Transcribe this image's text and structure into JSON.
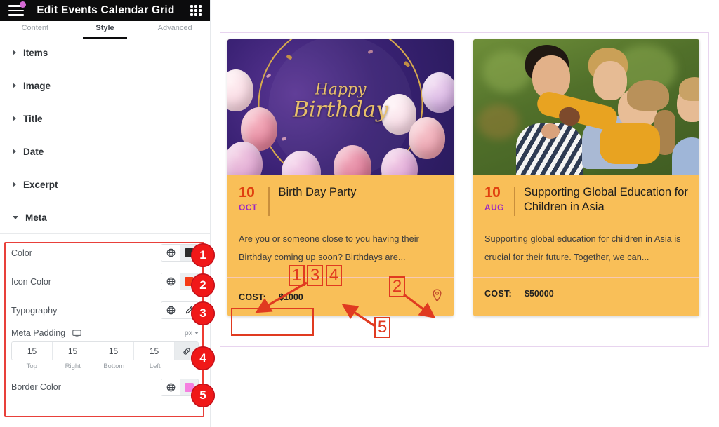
{
  "topbar": {
    "menu_icon": "hamburger-menu-icon",
    "title": "Edit Events Calendar Grid",
    "apps_icon": "apps-grid-icon",
    "badge_color": "#d66bd6"
  },
  "tabs": [
    {
      "label": "Content",
      "active": false
    },
    {
      "label": "Style",
      "active": true
    },
    {
      "label": "Advanced",
      "active": false
    }
  ],
  "sections": [
    {
      "label": "Items",
      "open": false
    },
    {
      "label": "Image",
      "open": false
    },
    {
      "label": "Title",
      "open": false
    },
    {
      "label": "Date",
      "open": false
    },
    {
      "label": "Excerpt",
      "open": false
    },
    {
      "label": "Meta",
      "open": true
    }
  ],
  "meta_controls": {
    "color": {
      "label": "Color",
      "globe_icon": "globe-icon",
      "swatch_icon": "color-swatch",
      "swatch_color": "#2c2c2c"
    },
    "icon_color": {
      "label": "Icon Color",
      "globe_icon": "globe-icon",
      "swatch_icon": "color-swatch",
      "swatch_color": "#f53b16"
    },
    "typography": {
      "label": "Typography",
      "globe_icon": "globe-icon",
      "edit_icon": "pencil-edit-icon"
    },
    "padding": {
      "label": "Meta Padding",
      "device_icon": "desktop-monitor-icon",
      "unit": "px",
      "unit_chevron": "chevron-down-icon",
      "values": [
        "15",
        "15",
        "15",
        "15"
      ],
      "sides": [
        "Top",
        "Right",
        "Bottom",
        "Left"
      ],
      "link_icon": "link-chain-icon"
    },
    "border_color": {
      "label": "Border Color",
      "globe_icon": "globe-icon",
      "swatch_icon": "color-swatch",
      "swatch_color": "#f57fe0"
    }
  },
  "badges": [
    "1",
    "2",
    "3",
    "4",
    "5"
  ],
  "annotations": {
    "preview_boxes": [
      "1",
      "3",
      "4",
      "2",
      "5"
    ]
  },
  "preview": {
    "cards": [
      {
        "image_alt": "happy-birthday-balloons-image",
        "image_text_line1": "Happy",
        "image_text_line2": "Birthday",
        "day": "10",
        "month": "OCT",
        "title": "Birth Day Party",
        "excerpt": "Are you or someone close to you having their Birthday coming up soon? Birthdays are...",
        "cost_label": "COST:",
        "cost_value": "$1000",
        "location_icon": "map-pin-icon"
      },
      {
        "image_alt": "children-hugging-outdoors-image",
        "day": "10",
        "month": "AUG",
        "title": "Supporting Global Education for Children in Asia",
        "excerpt": "Supporting global education for children in Asia is crucial for their future. Together, we can...",
        "cost_label": "COST:",
        "cost_value": "$50000"
      }
    ],
    "card_bg_color": "#f9bf58",
    "day_color": "#e0400f",
    "month_color": "#9b26c4",
    "meta_border_color": "#f6c9b4"
  }
}
